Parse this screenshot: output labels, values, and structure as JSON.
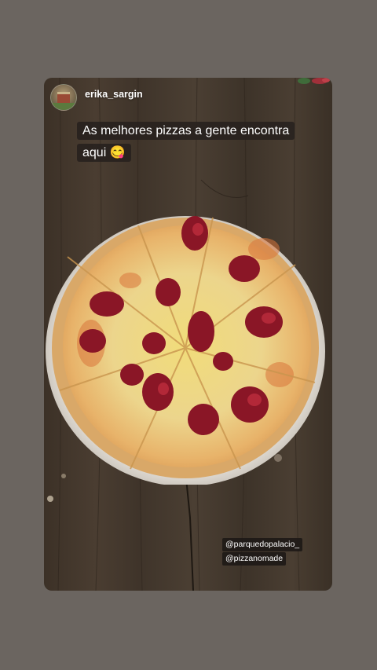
{
  "story": {
    "username": "erika_sargin",
    "caption": "As melhores pizzas a gente encontra aqui 😋",
    "caption_line1": "As melhores pizzas a gente encontra",
    "caption_line2": "aqui 😋",
    "tags": [
      "@parquedopalacio_",
      "@pizzanomade"
    ],
    "background_color": "#6b6560",
    "caption_bg": "#28221e"
  },
  "icons": {
    "avatar": "profile-avatar",
    "corner_sticker": "flower-icon"
  }
}
